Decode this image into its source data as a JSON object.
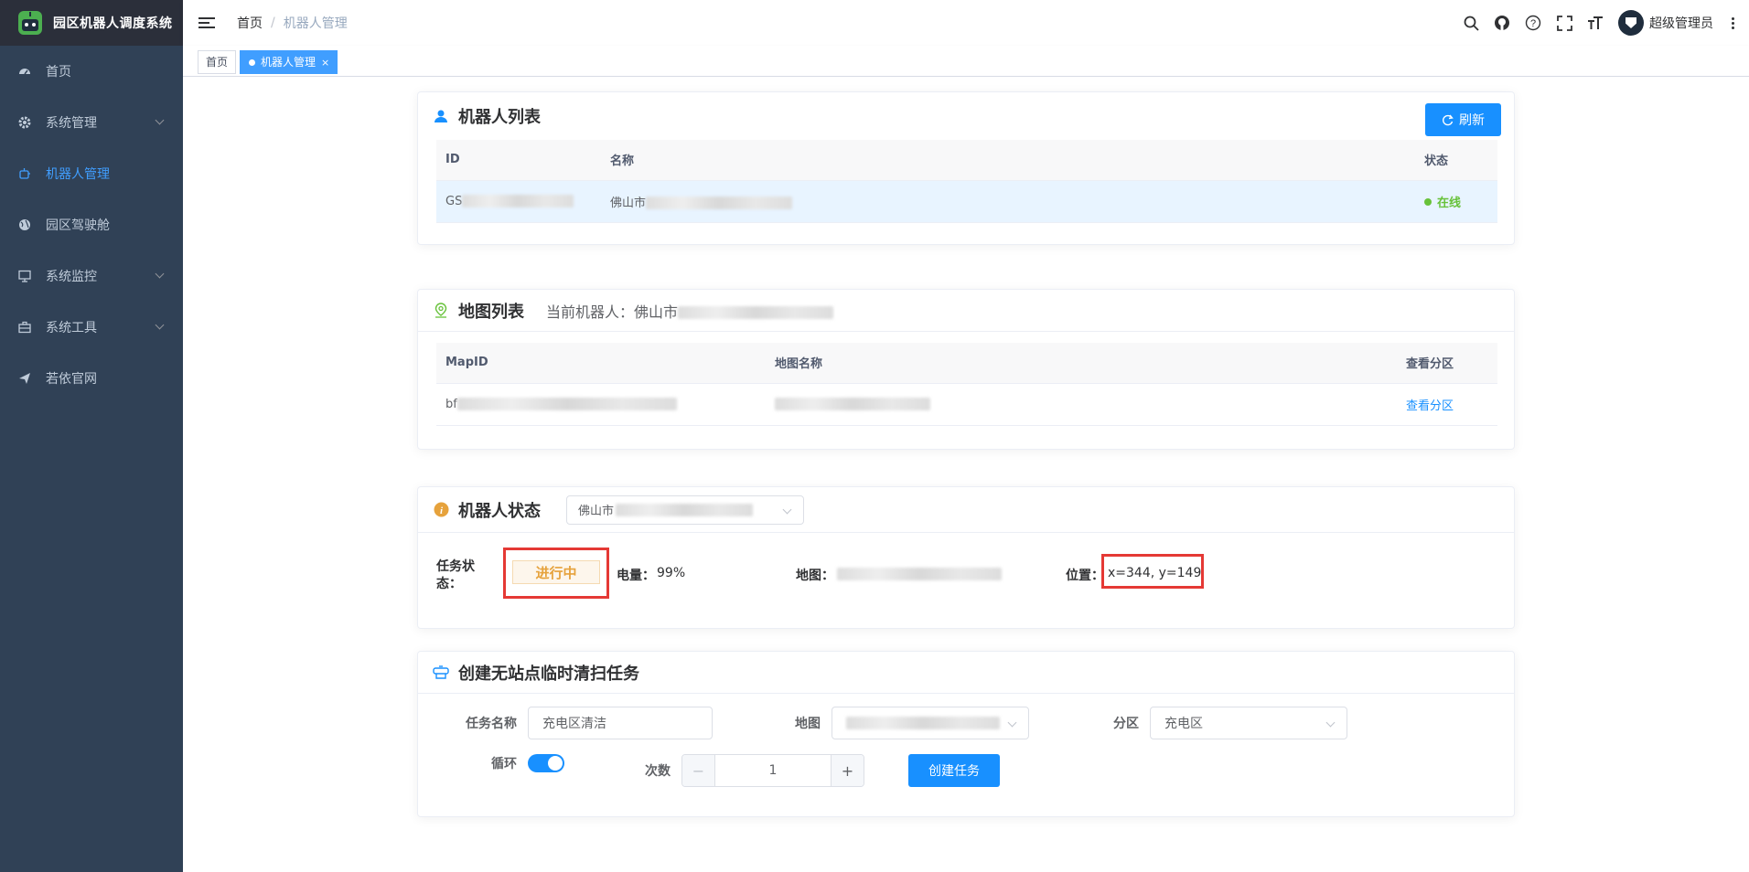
{
  "app": {
    "title": "园区机器人调度系统"
  },
  "sidebar": {
    "items": [
      {
        "label": "首页",
        "icon": "dashboard-icon"
      },
      {
        "label": "系统管理",
        "icon": "gear-icon"
      },
      {
        "label": "机器人管理",
        "icon": "robot-icon"
      },
      {
        "label": "园区驾驶舱",
        "icon": "globe-icon"
      },
      {
        "label": "系统监控",
        "icon": "monitor-icon"
      },
      {
        "label": "系统工具",
        "icon": "toolbox-icon"
      },
      {
        "label": "若依官网",
        "icon": "send-icon"
      }
    ]
  },
  "navbar": {
    "breadcrumb": {
      "home": "首页",
      "sep": "/",
      "current": "机器人管理"
    },
    "user": "超级管理员"
  },
  "tags": [
    {
      "label": "首页"
    },
    {
      "label": "机器人管理",
      "close": "×"
    }
  ],
  "robot_list": {
    "title": "机器人列表",
    "refresh_label": "刷新",
    "columns": [
      "ID",
      "名称",
      "状态"
    ],
    "rows": [
      {
        "id": "GS",
        "name": "佛山市",
        "status": "在线"
      }
    ]
  },
  "map_list": {
    "title": "地图列表",
    "current_robot_label": "当前机器人：佛山市",
    "columns": [
      "MapID",
      "地图名称",
      "查看分区"
    ],
    "rows": [
      {
        "map_id": "bf",
        "map_name": "",
        "action": "查看分区"
      }
    ]
  },
  "robot_status": {
    "title": "机器人状态",
    "select_value": "佛山市",
    "task_status_label": "任务状态：",
    "task_status_value": "进行中",
    "battery_label": "电量：",
    "battery_value": "99%",
    "map_label": "地图：",
    "position_label": "位置：",
    "position_value": "x=344, y=149"
  },
  "create_task": {
    "title": "创建无站点临时清扫任务",
    "task_name_label": "任务名称",
    "task_name_value": "充电区清洁",
    "map_label": "地图",
    "zone_label": "分区",
    "zone_value": "充电区",
    "loop_label": "循环",
    "loop_on": true,
    "count_label": "次数",
    "count_value": "1",
    "minus": "−",
    "plus": "+",
    "submit_label": "创建任务"
  },
  "colors": {
    "primary": "#1890ff",
    "sidebar_bg": "#304156",
    "success": "#67c23a",
    "warning": "#e6a23c",
    "highlight_border": "#e53935"
  }
}
